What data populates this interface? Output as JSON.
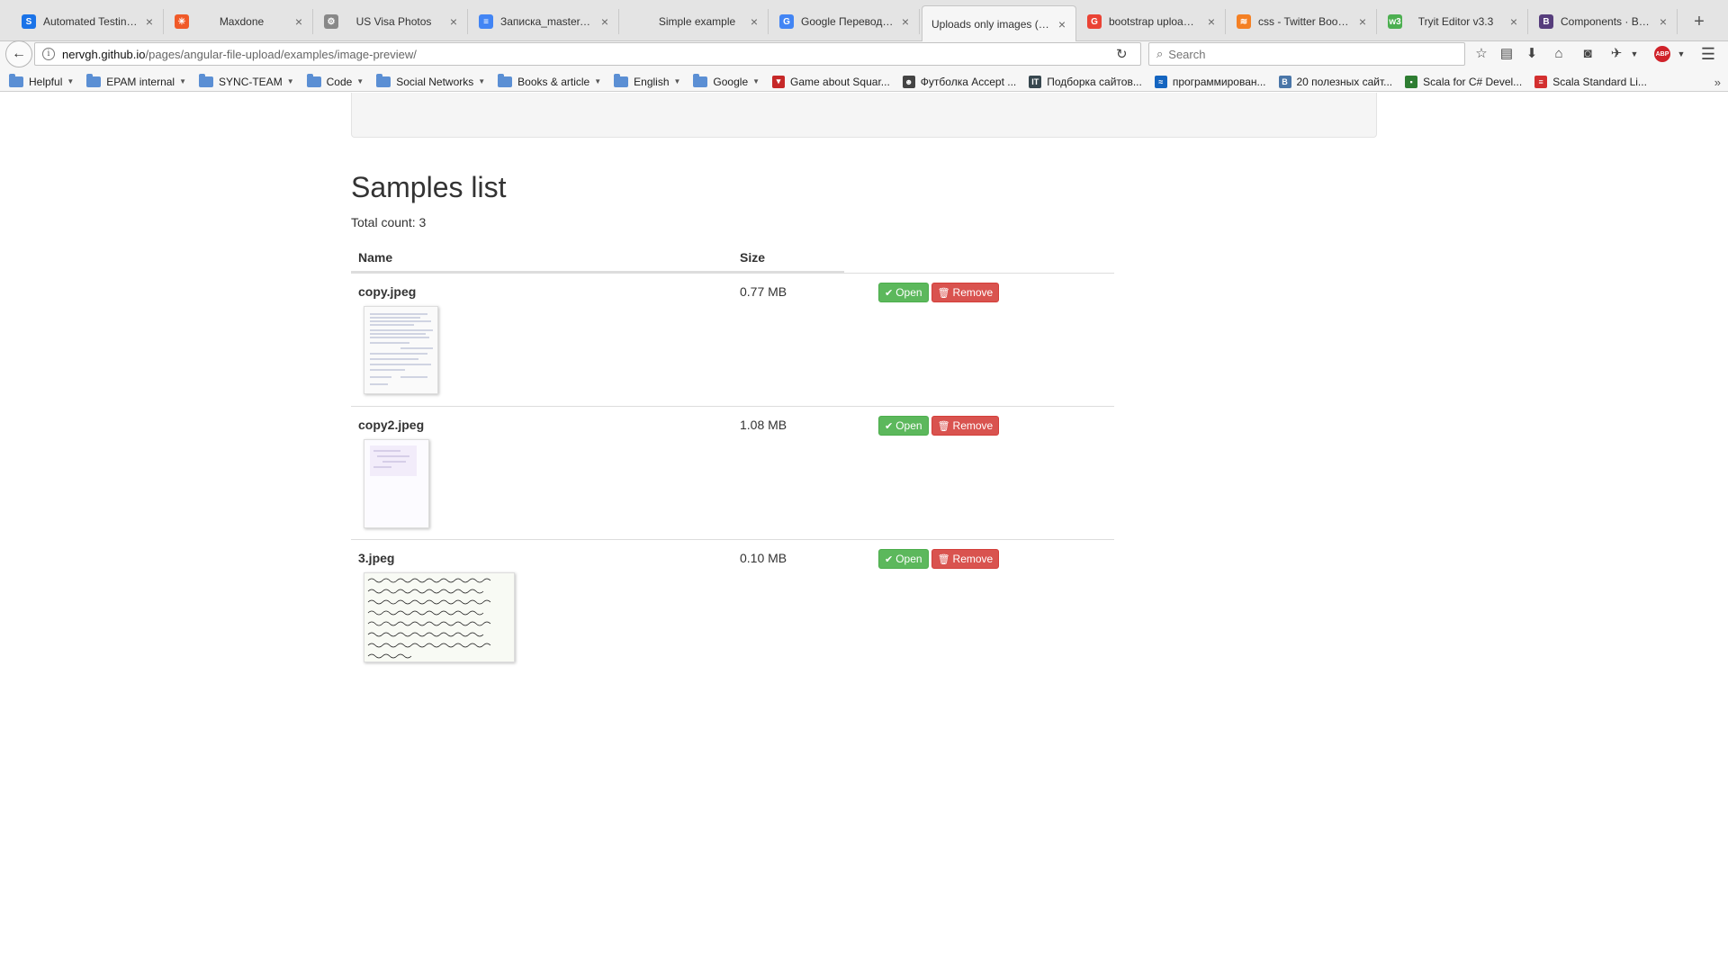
{
  "browser": {
    "tabs": [
      {
        "title": "Automated Testing...",
        "favicon": "S",
        "favicon_color": "#1a73e8"
      },
      {
        "title": "Maxdone",
        "favicon": "✳",
        "favicon_color": "#f05a28"
      },
      {
        "title": "US Visa Photos",
        "favicon": "⚙",
        "favicon_color": "#888888"
      },
      {
        "title": "Записка_master.d...",
        "favicon": "≡",
        "favicon_color": "#4285f4"
      },
      {
        "title": "Simple example",
        "favicon": "",
        "favicon_color": "transparent"
      },
      {
        "title": "Google Переводчик",
        "favicon": "G",
        "favicon_color": "#4285f4"
      },
      {
        "title": "Uploads only images (w...",
        "favicon": "",
        "favicon_color": "transparent",
        "active": true
      },
      {
        "title": "bootstrap upload b...",
        "favicon": "G",
        "favicon_color": "#ea4335"
      },
      {
        "title": "css - Twitter Boots...",
        "favicon": "≋",
        "favicon_color": "#f48024"
      },
      {
        "title": "Tryit Editor v3.3",
        "favicon": "w3",
        "favicon_color": "#4caf50"
      },
      {
        "title": "Components · Boot...",
        "favicon": "B",
        "favicon_color": "#563d7c"
      }
    ],
    "address": {
      "host": "nervgh.github.io",
      "path": "/pages/angular-file-upload/examples/image-preview/"
    },
    "search_placeholder": "Search",
    "bookmarks": [
      {
        "label": "Helpful",
        "type": "folder"
      },
      {
        "label": "EPAM internal",
        "type": "folder"
      },
      {
        "label": "SYNC-TEAM",
        "type": "folder"
      },
      {
        "label": "Code",
        "type": "folder"
      },
      {
        "label": "Social Networks",
        "type": "folder"
      },
      {
        "label": "Books & article",
        "type": "folder"
      },
      {
        "label": "English",
        "type": "folder"
      },
      {
        "label": "Google",
        "type": "folder"
      },
      {
        "label": "Game about Squar...",
        "type": "link",
        "favicon": "▾",
        "favicon_color": "#c62828"
      },
      {
        "label": "Футболка Accept ...",
        "type": "link",
        "favicon": "☻",
        "favicon_color": "#444444"
      },
      {
        "label": "Подборка сайтов...",
        "type": "link",
        "favicon": "IT",
        "favicon_color": "#37474f"
      },
      {
        "label": "программирован...",
        "type": "link",
        "favicon": "≈",
        "favicon_color": "#1565c0"
      },
      {
        "label": "20 полезных сайт...",
        "type": "link",
        "favicon": "B",
        "favicon_color": "#4a76a8"
      },
      {
        "label": "Scala for C# Devel...",
        "type": "link",
        "favicon": "▪",
        "favicon_color": "#2e7d32"
      },
      {
        "label": "Scala Standard Li...",
        "type": "link",
        "favicon": "≡",
        "favicon_color": "#d32f2f"
      }
    ]
  },
  "page": {
    "title": "Samples list",
    "total_count": "Total count: 3",
    "columns": {
      "name": "Name",
      "size": "Size"
    },
    "buttons": {
      "open": "Open",
      "remove": "Remove"
    },
    "files": [
      {
        "name": "copy.jpeg",
        "size": "0.77 MB"
      },
      {
        "name": "copy2.jpeg",
        "size": "1.08 MB"
      },
      {
        "name": "3.jpeg",
        "size": "0.10 MB"
      }
    ]
  },
  "colors": {
    "success": "#5cb85c",
    "danger": "#d9534f"
  }
}
